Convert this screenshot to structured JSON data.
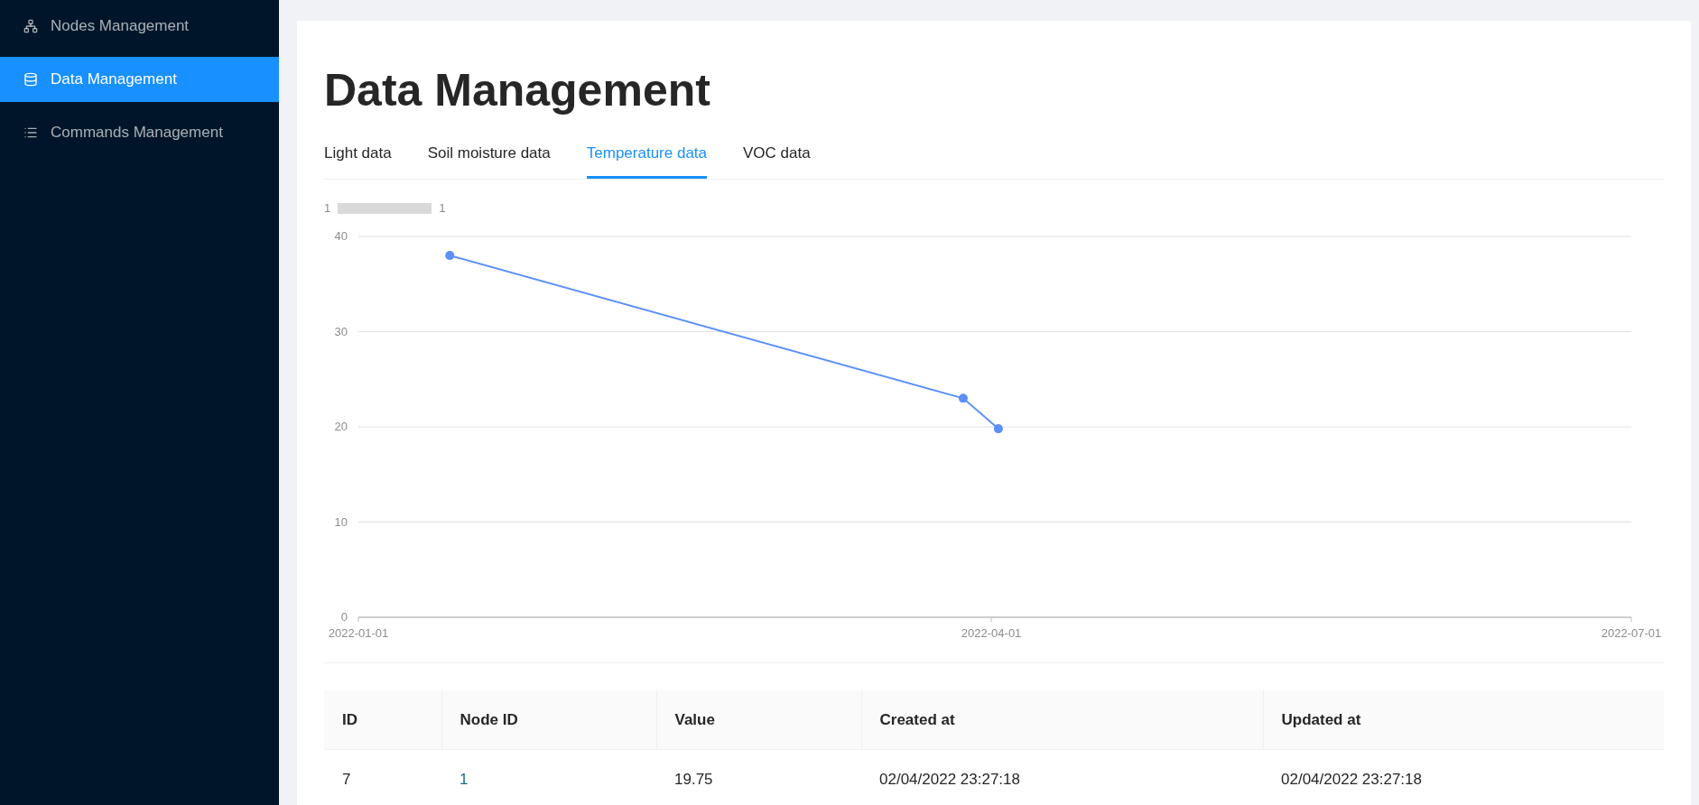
{
  "sidebar": {
    "items": [
      {
        "label": "Nodes Management",
        "selected": false
      },
      {
        "label": "Data Management",
        "selected": true
      },
      {
        "label": "Commands Management",
        "selected": false
      }
    ]
  },
  "page": {
    "title": "Data Management"
  },
  "tabs": [
    {
      "label": "Light data",
      "selected": false
    },
    {
      "label": "Soil moisture data",
      "selected": false
    },
    {
      "label": "Temperature data",
      "selected": true
    },
    {
      "label": "VOC data",
      "selected": false
    }
  ],
  "chart": {
    "legend": {
      "max_label": "1"
    },
    "chart_data": {
      "type": "line",
      "x": [
        "2022-01-14",
        "2022-03-28",
        "2022-04-02"
      ],
      "series": [
        {
          "name": "1",
          "color": "#5b8ff9",
          "marker": true,
          "values": [
            38,
            23,
            19.8
          ]
        }
      ],
      "xlim": [
        "2022-01-01",
        "2022-07-01"
      ],
      "ylim": [
        0,
        40
      ],
      "yticks": [
        0,
        10,
        20,
        30,
        40
      ],
      "grid": true,
      "xticks": [
        {
          "value": "2022-01-01",
          "label": "2022-01-01"
        },
        {
          "value": "2022-04-01",
          "label": "2022-04-01"
        },
        {
          "value": "2022-07-01",
          "label": "2022-07-01"
        }
      ]
    }
  },
  "table": {
    "columns": [
      "ID",
      "Node ID",
      "Value",
      "Created at",
      "Updated at"
    ],
    "rows": [
      {
        "id": "7",
        "node_id": "1",
        "value": "19.75",
        "created_at": "02/04/2022 23:27:18",
        "updated_at": "02/04/2022 23:27:18"
      }
    ]
  }
}
